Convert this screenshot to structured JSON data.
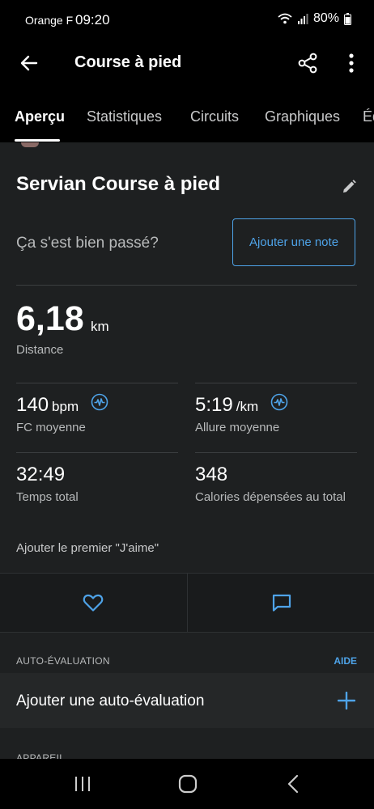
{
  "status_bar": {
    "carrier": "Orange F",
    "time": "09:20",
    "battery": "80%",
    "icons": [
      "wifi-icon",
      "signal-icon",
      "battery-icon"
    ]
  },
  "app_bar": {
    "title": "Course à pied",
    "icons": [
      "back-arrow-icon",
      "share-icon",
      "more-vert-icon"
    ]
  },
  "tabs": [
    {
      "label": "Aperçu",
      "active": true
    },
    {
      "label": "Statistiques",
      "active": false
    },
    {
      "label": "Circuits",
      "active": false
    },
    {
      "label": "Graphiques",
      "active": false
    },
    {
      "label": "Éq",
      "active": false
    }
  ],
  "activity": {
    "title": "Servian Course à pied",
    "feeling_question": "Ça s'est bien passé?",
    "add_note_label": "Ajouter une note"
  },
  "distance": {
    "value": "6,18",
    "unit": "km",
    "label": "Distance"
  },
  "stats": [
    {
      "value": "140",
      "unit": "bpm",
      "label": "FC moyenne",
      "icon": "pulse-icon"
    },
    {
      "value": "5:19",
      "unit": "/km",
      "label": "Allure moyenne",
      "icon": "pulse-icon"
    },
    {
      "value": "32:49",
      "unit": "",
      "label": "Temps total"
    },
    {
      "value": "348",
      "unit": "",
      "label": "Calories dépensées au total"
    }
  ],
  "social": {
    "like_prompt": "Ajouter le premier \"J'aime\"",
    "icons": [
      "heart-icon",
      "comment-icon"
    ]
  },
  "self_evaluation": {
    "section_label": "AUTO-ÉVALUATION",
    "help_label": "AIDE",
    "add_label": "Ajouter une auto-évaluation"
  },
  "device": {
    "section_label": "APPAREIL"
  },
  "colors": {
    "accent": "#4ea3e8",
    "background": "#1e2021",
    "bar": "#000000"
  }
}
